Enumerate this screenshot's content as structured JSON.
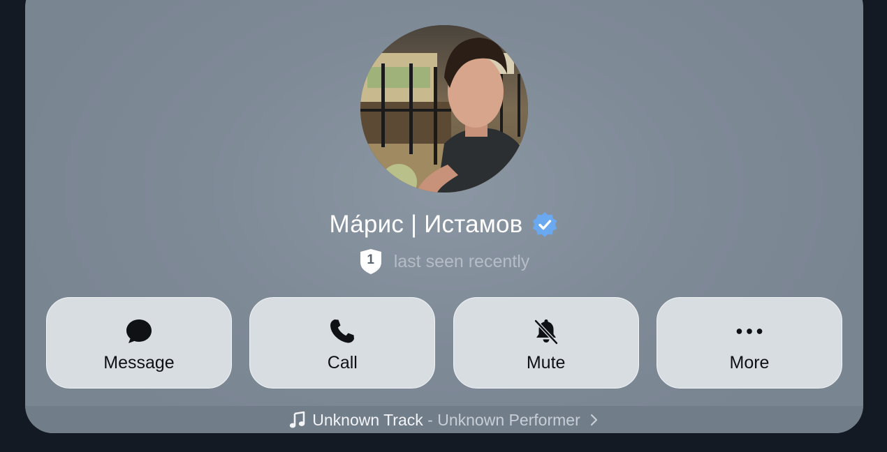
{
  "profile": {
    "name": "Ма́рис | Истамов",
    "status": "last seen recently",
    "badge_number": "1",
    "avatar_icon": "avatar-photo",
    "verified_icon": "verified-badge-icon",
    "verified_color": "#6aa8f0"
  },
  "actions": [
    {
      "label": "Message",
      "icon": "message-bubble-icon"
    },
    {
      "label": "Call",
      "icon": "phone-icon"
    },
    {
      "label": "Mute",
      "icon": "bell-slash-icon"
    },
    {
      "label": "More",
      "icon": "ellipsis-icon"
    }
  ],
  "music": {
    "title": "Unknown Track",
    "separator": " - ",
    "performer": "Unknown Performer",
    "icon": "music-note-icon",
    "chevron": "chevron-right-icon"
  },
  "colors": {
    "page_background": "#131a23",
    "card_background": "#808b98",
    "button_background": "#d8dde2"
  }
}
